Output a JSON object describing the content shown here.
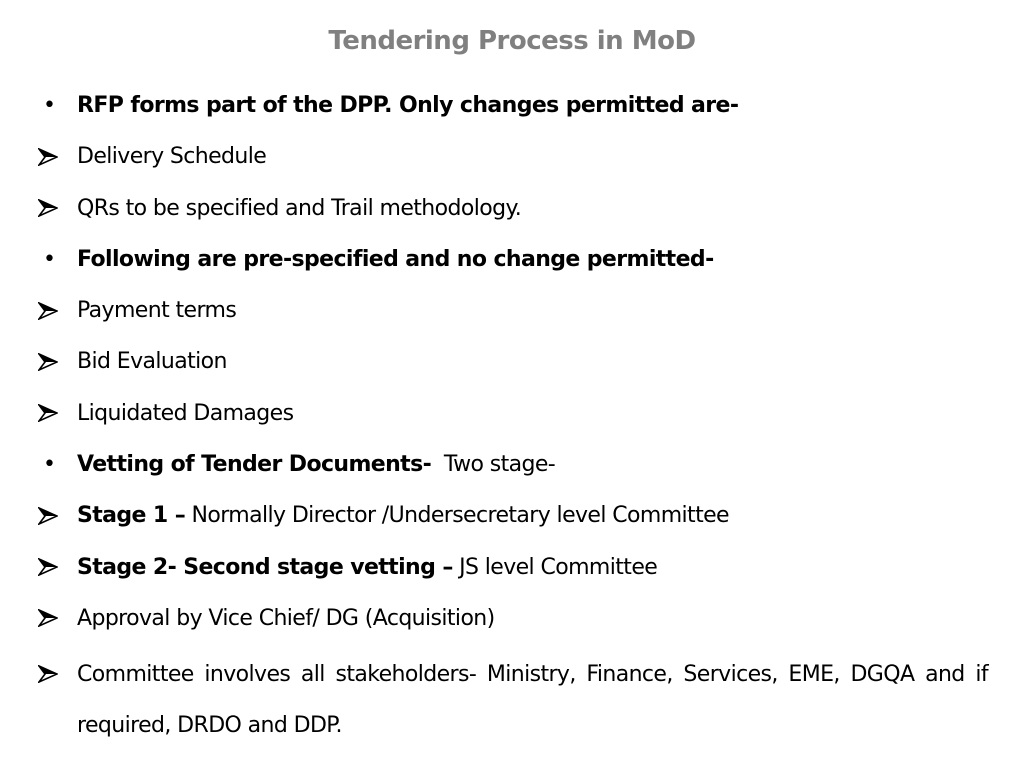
{
  "slide": {
    "title": "Tendering Process in MoD",
    "items": [
      {
        "marker": "bullet",
        "bold": "RFP forms part of the DPP. Only changes permitted are-",
        "normal": ""
      },
      {
        "marker": "arrow",
        "bold": "",
        "normal": "Delivery Schedule"
      },
      {
        "marker": "arrow",
        "bold": "",
        "normal": "QRs to be specified and Trail methodology."
      },
      {
        "marker": "bullet",
        "bold": "Following are pre-specified and no change permitted-",
        "normal": ""
      },
      {
        "marker": "arrow",
        "bold": "",
        "normal": "Payment terms"
      },
      {
        "marker": "arrow",
        "bold": "",
        "normal": "Bid Evaluation"
      },
      {
        "marker": "arrow",
        "bold": "",
        "normal": "Liquidated Damages"
      },
      {
        "marker": "bullet",
        "bold": "Vetting of Tender Documents-",
        "normal": "  Two stage-"
      },
      {
        "marker": "arrow",
        "bold": "Stage 1 –",
        "normal": " Normally Director /Undersecretary level Committee"
      },
      {
        "marker": "arrow",
        "bold": "Stage 2- Second stage vetting –",
        "normal": " JS level Committee"
      },
      {
        "marker": "arrow",
        "bold": "",
        "normal": "Approval by Vice Chief/ DG (Acquisition)"
      },
      {
        "marker": "arrow",
        "bold": "",
        "normal": "Committee involves all stakeholders- Ministry, Finance, Services, EME, DGQA and if required, DRDO and DDP."
      }
    ]
  },
  "markers": {
    "bullet": "•",
    "arrow": "arrow-icon"
  },
  "colors": {
    "title": "#808080",
    "text": "#000000",
    "background": "#ffffff"
  }
}
